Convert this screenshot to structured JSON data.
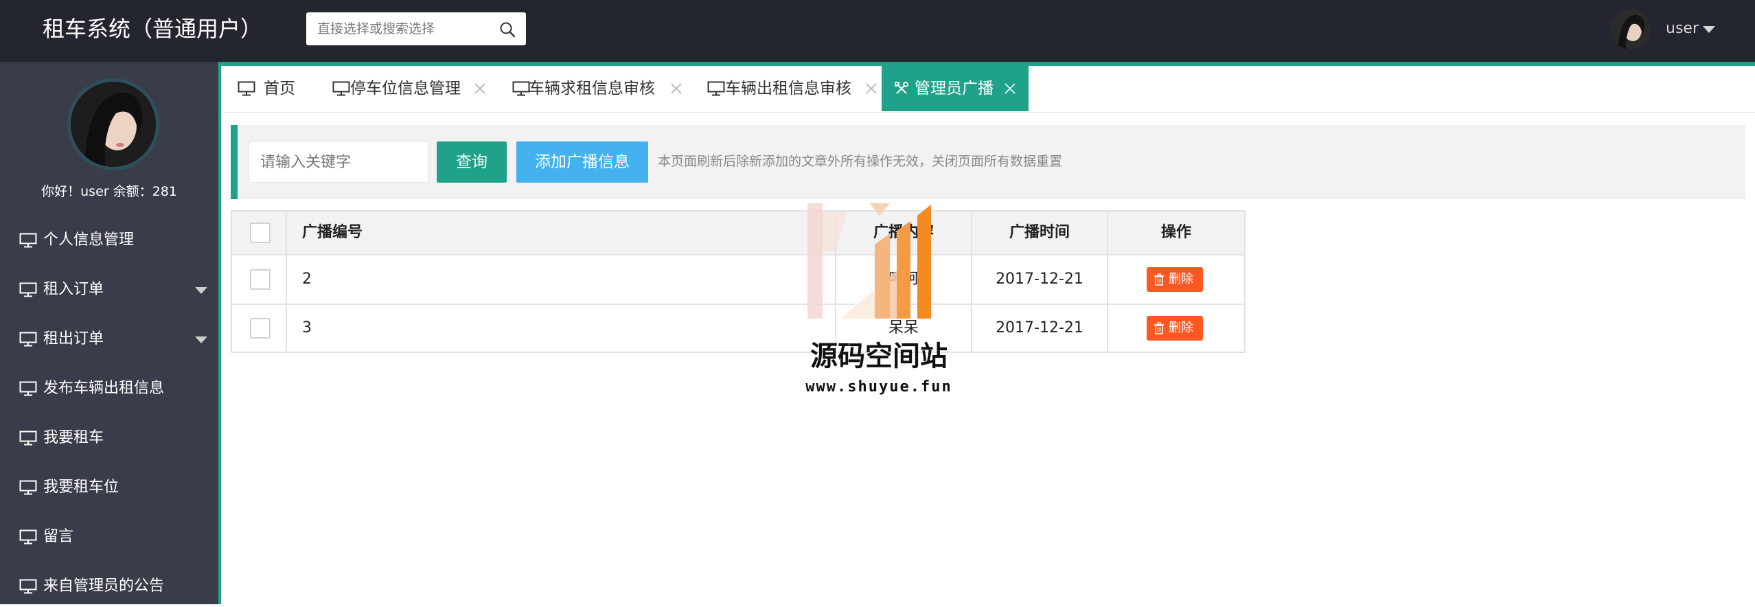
{
  "app": {
    "title": "租车系统（普通用户）",
    "search_placeholder": "直接选择或搜索选择",
    "user_name": "user",
    "accent_color": "#1fa18a"
  },
  "sidebar": {
    "greeting": "你好！user 余额：281",
    "items": [
      {
        "label": "个人信息管理",
        "icon": "monitor-icon",
        "has_caret": false
      },
      {
        "label": "租入订单",
        "icon": "monitor-icon",
        "has_caret": true
      },
      {
        "label": "租出订单",
        "icon": "monitor-icon",
        "has_caret": true
      },
      {
        "label": "发布车辆出租信息",
        "icon": "monitor-icon",
        "has_caret": false
      },
      {
        "label": "我要租车",
        "icon": "monitor-icon",
        "has_caret": false
      },
      {
        "label": "我要租车位",
        "icon": "monitor-icon",
        "has_caret": false
      },
      {
        "label": "留言",
        "icon": "monitor-icon",
        "has_caret": false
      },
      {
        "label": "来自管理员的公告",
        "icon": "monitor-icon",
        "has_caret": false
      }
    ]
  },
  "tabs": [
    {
      "label": "首页",
      "icon": "monitor-icon",
      "closable": false,
      "active": false
    },
    {
      "label": "停车位信息管理",
      "icon": "monitor-icon",
      "closable": true,
      "active": false
    },
    {
      "label": "车辆求租信息审核",
      "icon": "monitor-icon",
      "closable": true,
      "active": false
    },
    {
      "label": "车辆出租信息审核",
      "icon": "monitor-icon",
      "closable": true,
      "active": false
    },
    {
      "label": "管理员广播",
      "icon": "tools-icon",
      "closable": true,
      "active": true
    }
  ],
  "toolbar": {
    "keyword_placeholder": "请输入关键字",
    "query_label": "查询",
    "add_label": "添加广播信息",
    "hint": "本页面刷新后除新添加的文章外所有操作无效，关闭页面所有数据重置"
  },
  "table": {
    "headers": [
      "广播编号",
      "广播内容",
      "广播时间",
      "操作"
    ],
    "rows": [
      {
        "id": "2",
        "content": "呵呵",
        "time": "2017-12-21",
        "action": "删除"
      },
      {
        "id": "3",
        "content": "呆呆",
        "time": "2017-12-21",
        "action": "删除"
      }
    ]
  },
  "watermark": {
    "title": "源码空间站",
    "url": "www.shuyue.fun"
  }
}
